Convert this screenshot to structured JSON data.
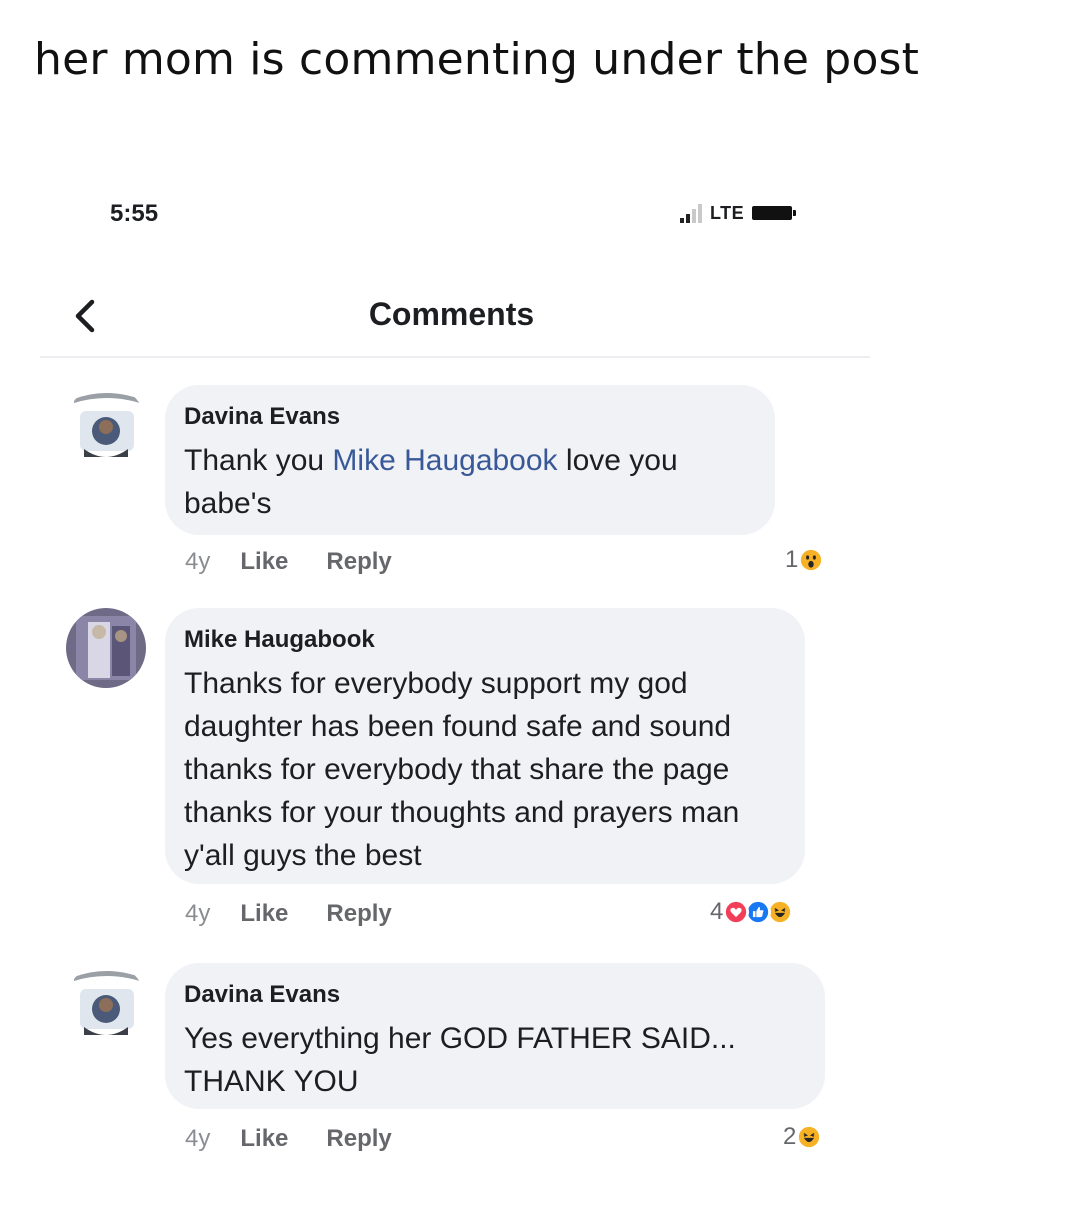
{
  "caption": "her mom is commenting under the post",
  "status_bar": {
    "time": "5:55",
    "network": "LTE"
  },
  "nav": {
    "title": "Comments"
  },
  "comments": [
    {
      "author": "Davina Evans",
      "text_before": "Thank you ",
      "mention": "Mike Haugabook",
      "text_after": " love you babe's",
      "age": "4y",
      "like_label": "Like",
      "reply_label": "Reply",
      "reaction_count": "1",
      "reaction_icons": [
        "wow-icon"
      ]
    },
    {
      "author": "Mike Haugabook",
      "text": "Thanks for everybody support my god daughter has been found safe and sound thanks for everybody that share the page thanks for your thoughts and prayers man y'all guys the best",
      "age": "4y",
      "like_label": "Like",
      "reply_label": "Reply",
      "reaction_count": "4",
      "reaction_icons": [
        "love-icon",
        "like-icon",
        "haha-icon"
      ]
    },
    {
      "author": "Davina Evans",
      "text": "Yes everything her GOD FATHER SAID... THANK YOU",
      "age": "4y",
      "like_label": "Like",
      "reply_label": "Reply",
      "reaction_count": "2",
      "reaction_icons": [
        "haha-icon"
      ]
    }
  ],
  "colors": {
    "bubble": "#f0f2f5",
    "mention": "#385898",
    "meta_text": "#65676b",
    "love": "#f33e58",
    "like": "#1877f2",
    "reaction_yellow": "#f7b125"
  }
}
